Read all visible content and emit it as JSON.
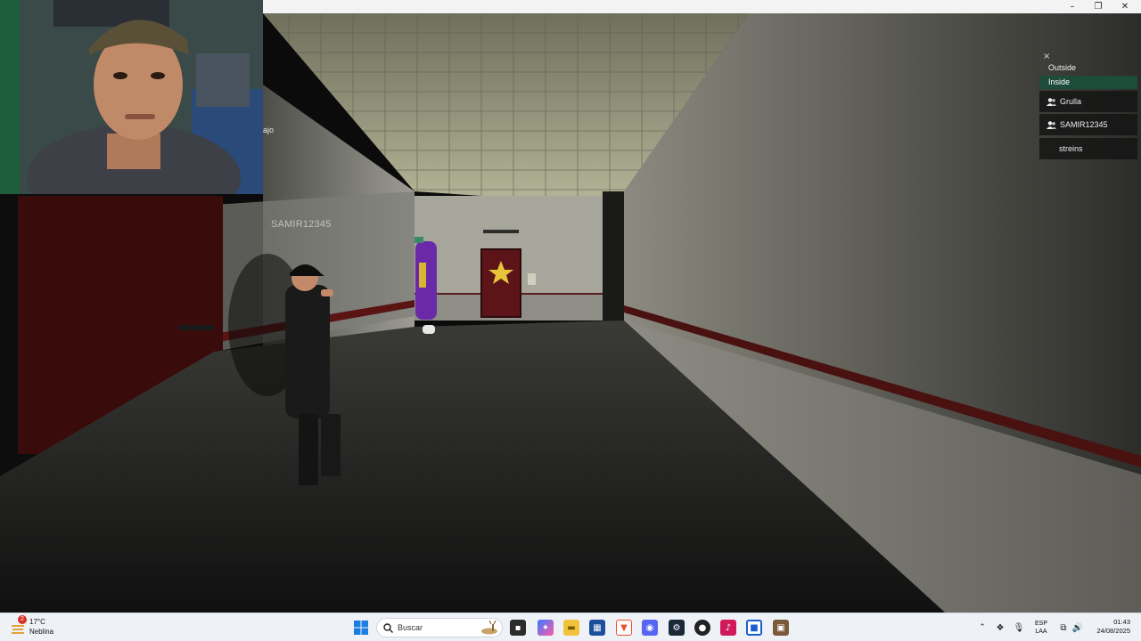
{
  "window": {
    "controls": {
      "minimize": "–",
      "maximize": "❐",
      "close": "✕"
    }
  },
  "scene": {
    "player_nametag": "SAMIR12345",
    "chat_fragment": "ajo"
  },
  "side_menu": {
    "close_symbol": "×",
    "options": [
      {
        "label": "Outside",
        "active": false
      },
      {
        "label": "Inside",
        "active": true
      }
    ],
    "players": [
      {
        "name": "Grulla",
        "icon": "people-icon"
      },
      {
        "name": "SAMIR12345",
        "icon": "people-icon"
      },
      {
        "name": "streins",
        "icon": ""
      }
    ],
    "accent": "#1d4c3b"
  },
  "taskbar": {
    "weather": {
      "temp": "17°C",
      "condition": "Neblina",
      "badge": "2"
    },
    "search_placeholder": "Buscar",
    "language": {
      "line1": "ESP",
      "line2": "LAA"
    },
    "clock": {
      "time": "01:43",
      "date": "24/08/2025"
    },
    "apps": [
      "start-icon",
      "search-icon",
      "deer-icon",
      "task-view-icon",
      "copilot-icon",
      "file-explorer-icon",
      "store-icon",
      "brave-icon",
      "discord-icon",
      "steam-icon",
      "obs-icon",
      "tiktok-icon",
      "app-icon",
      "roblox-icon"
    ]
  }
}
